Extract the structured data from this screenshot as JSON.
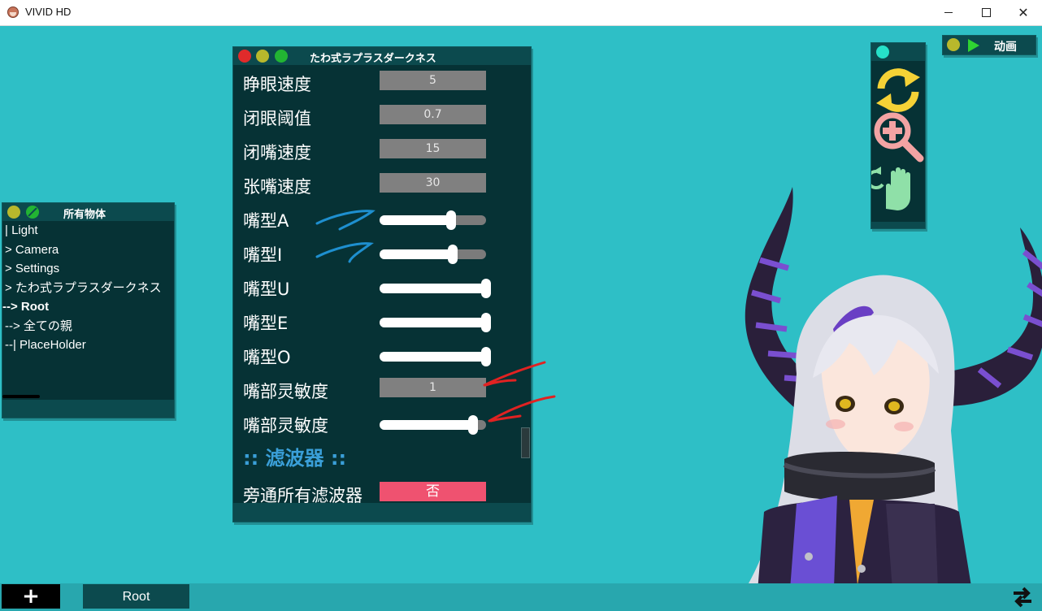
{
  "window": {
    "title": "VIVID HD",
    "controls": {
      "minimize": "minimize",
      "maximize": "maximize",
      "close": "✕"
    }
  },
  "objects_panel": {
    "title": "所有物体",
    "items": [
      {
        "label": "| Light",
        "active": false
      },
      {
        "label": "> Camera",
        "active": false
      },
      {
        "label": "> Settings",
        "active": false
      },
      {
        "label": "> たわ式ラプラスダークネス",
        "active": false
      },
      {
        "label": "--> Root",
        "active": true
      },
      {
        "label": "--> 全ての親",
        "active": false
      },
      {
        "label": "--| PlaceHolder",
        "active": false
      }
    ]
  },
  "params_panel": {
    "title": "たわ式ラプラスダークネス",
    "rows": [
      {
        "label": "睁眼速度",
        "type": "number",
        "value": "5"
      },
      {
        "label": "闭眼阈值",
        "type": "number",
        "value": "0.7"
      },
      {
        "label": "闭嘴速度",
        "type": "number",
        "value": "15"
      },
      {
        "label": "张嘴速度",
        "type": "number",
        "value": "30"
      },
      {
        "label": "嘴型A",
        "type": "slider",
        "level": 0.67
      },
      {
        "label": "嘴型I",
        "type": "slider",
        "level": 0.69
      },
      {
        "label": "嘴型U",
        "type": "slider",
        "level": 1.0
      },
      {
        "label": "嘴型E",
        "type": "slider",
        "level": 1.0
      },
      {
        "label": "嘴型O",
        "type": "slider",
        "level": 1.0
      },
      {
        "label": "嘴部灵敏度",
        "type": "number",
        "value": "1"
      },
      {
        "label": "嘴部灵敏度",
        "type": "slider",
        "level": 0.88
      }
    ],
    "section": ":: 滤波器 ::",
    "bypass": {
      "label": "旁通所有滤波器",
      "value": "否"
    }
  },
  "tools": {
    "icons": [
      "refresh-icon",
      "zoom-in-icon",
      "hand-rotate-icon"
    ]
  },
  "anim_panel": {
    "label": "动画"
  },
  "bottom_bar": {
    "add_label": "+",
    "tab_label": "Root"
  },
  "colors": {
    "background": "#2ebfc6",
    "panel": "#063235",
    "panel_header": "#0c4a4e",
    "section_title": "#3a9fd8",
    "bool_false": "#ef5270"
  }
}
